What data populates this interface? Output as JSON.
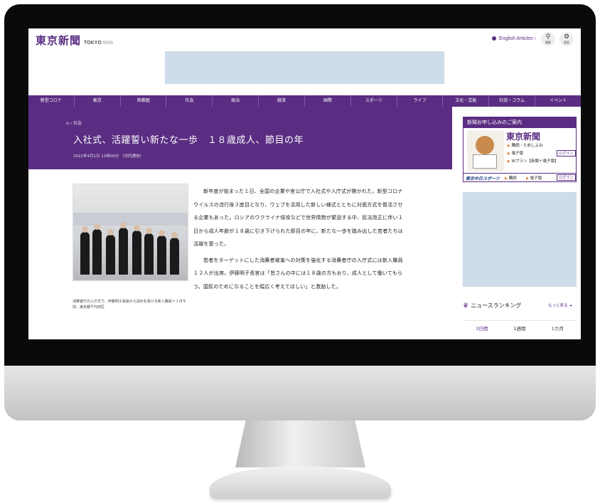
{
  "site": {
    "logo": "東京新聞",
    "logo_sub": "TOKYO",
    "logo_web": "Web",
    "english": "English Articles",
    "search_label": "検索",
    "settings_label": "設定"
  },
  "nav": [
    "新型コロナ",
    "東京",
    "首都圏",
    "社会",
    "政治",
    "経済",
    "国際",
    "スポーツ",
    "ライフ",
    "文化・芸能",
    "社説・コラム",
    "イベント"
  ],
  "article": {
    "breadcrumb": "社会",
    "title": "入社式、活躍誓い新たな一歩　１８歳成人、節目の年",
    "date": "2022年4月1日 11時00分 （共同通信）",
    "caption": "消費者庁の入庁式で、伊藤明子長官から訓示を受ける新入職員＝１日午前、東京都千代田区",
    "paragraphs": [
      "新年度が始まった１日、全国の企業や官公庁で入社式や入庁式が開かれた。新型コロナウイルスの流行後３度目となり、ウェブを活用した新しい様式とともに対面方式を復活させる企業もあった。ロシアのウクライナ侵攻などで世界情勢が緊迫する中、民法改正に伴い１日から成人年齢が１８歳に引き下げられた節目の年に、新たな一歩を踏み出した若者たちは活躍を誓った。",
      "若者をターゲットにした消費者被害への対策を強化する消費者庁の入庁式には新入職員１２人が出席。伊藤明子長官は「皆さんの中には１８歳の方もおり、成人として働いてもらう。国民のためになることを幅広く考えてほしい」と激励した。"
    ]
  },
  "sidebar": {
    "promo_title": "新聞お申し込みのご案内",
    "promo_logo": "東京新聞",
    "promo_items": [
      "購読・ためしよみ",
      "電子版",
      "Wプラン【新聞＋電子版】"
    ],
    "login": "ログイン",
    "sports_logo": "東京中日スポーツ",
    "sports_items": [
      "購読",
      "電子版"
    ],
    "ranking_title": "ニュースランキング",
    "ranking_more": "もっと見る",
    "ranking_tabs": [
      "3日間",
      "1週間",
      "1カ月"
    ]
  }
}
